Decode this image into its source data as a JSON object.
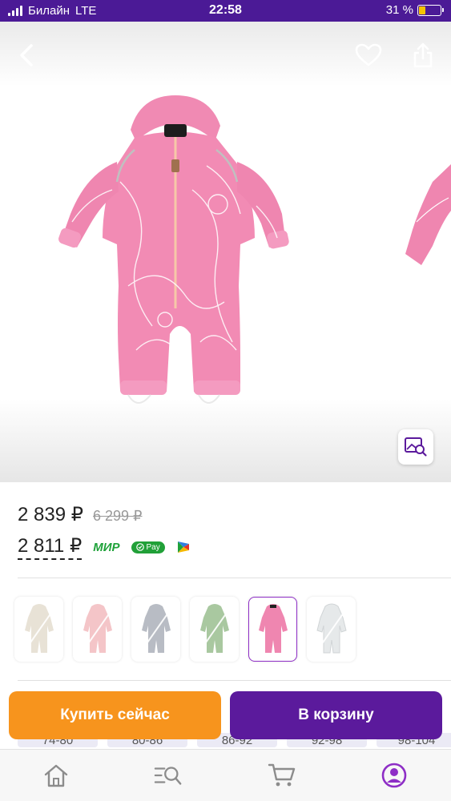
{
  "status": {
    "carrier": "Билайн",
    "network": "LTE",
    "time": "22:58",
    "battery": "31 %",
    "battery_level": 0.31
  },
  "gallery": {
    "icons": [
      "back-icon",
      "heart-icon",
      "share-icon",
      "image-search-icon"
    ]
  },
  "price": {
    "current": "2 839 ₽",
    "old": "6 299 ₽",
    "card_price": "2 811 ₽",
    "mir_label": "МИР",
    "spay_label": "Pay"
  },
  "variants": [
    {
      "color": "#e8e2d6",
      "available": false,
      "selected": false
    },
    {
      "color": "#f4c5c8",
      "available": false,
      "selected": false
    },
    {
      "color": "#b8bcc4",
      "available": false,
      "selected": false
    },
    {
      "color": "#a9c8a0",
      "available": false,
      "selected": false
    },
    {
      "color": "#ef86b0",
      "available": true,
      "selected": true
    },
    {
      "color": "#e6e9ea",
      "available": false,
      "selected": false
    }
  ],
  "sizes": [
    "74-80",
    "80-86",
    "86-92",
    "92-98",
    "98-104"
  ],
  "buttons": {
    "buy_now": "Купить сейчас",
    "add_to_cart": "В корзину"
  },
  "nav": [
    "home-icon",
    "catalog-search-icon",
    "cart-icon",
    "profile-icon"
  ],
  "colors": {
    "brand_purple": "#5b1a9c",
    "status_bar": "#4b1a96",
    "buy_orange": "#f7941d",
    "product_pink": "#f28bb4"
  }
}
